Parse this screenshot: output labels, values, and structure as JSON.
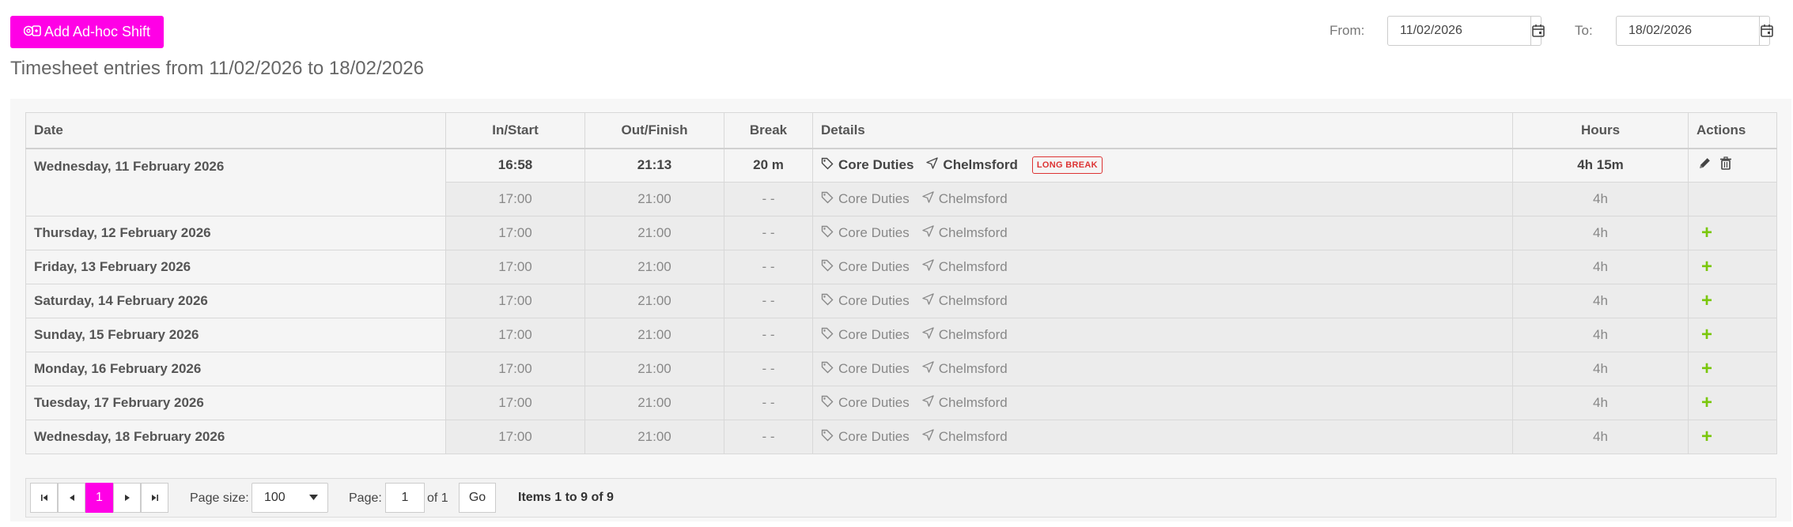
{
  "toolbar": {
    "add_shift_label": "Add Ad-hoc Shift",
    "from_label": "From:",
    "from_value": "11/02/2026",
    "to_label": "To:",
    "to_value": "18/02/2026"
  },
  "subtitle": "Timesheet entries from 11/02/2026 to 18/02/2026",
  "table": {
    "headers": {
      "date": "Date",
      "in_start": "In/Start",
      "out_finish": "Out/Finish",
      "break": "Break",
      "details": "Details",
      "hours": "Hours",
      "actions": "Actions"
    },
    "first_day": {
      "date": "Wednesday, 11 February 2026",
      "actual": {
        "in": "16:58",
        "out": "21:13",
        "break": "20 m",
        "duty": "Core Duties",
        "location": "Chelmsford",
        "badge": "LONG BREAK",
        "hours": "4h 15m"
      },
      "scheduled": {
        "in": "17:00",
        "out": "21:00",
        "break": "- -",
        "duty": "Core Duties",
        "location": "Chelmsford",
        "hours": "4h"
      }
    },
    "rows": [
      {
        "date": "Thursday, 12 February 2026",
        "in": "17:00",
        "out": "21:00",
        "break": "- -",
        "duty": "Core Duties",
        "location": "Chelmsford",
        "hours": "4h",
        "action": "+"
      },
      {
        "date": "Friday, 13 February 2026",
        "in": "17:00",
        "out": "21:00",
        "break": "- -",
        "duty": "Core Duties",
        "location": "Chelmsford",
        "hours": "4h",
        "action": "+"
      },
      {
        "date": "Saturday, 14 February 2026",
        "in": "17:00",
        "out": "21:00",
        "break": "- -",
        "duty": "Core Duties",
        "location": "Chelmsford",
        "hours": "4h",
        "action": "+"
      },
      {
        "date": "Sunday, 15 February 2026",
        "in": "17:00",
        "out": "21:00",
        "break": "- -",
        "duty": "Core Duties",
        "location": "Chelmsford",
        "hours": "4h",
        "action": "+"
      },
      {
        "date": "Monday, 16 February 2026",
        "in": "17:00",
        "out": "21:00",
        "break": "- -",
        "duty": "Core Duties",
        "location": "Chelmsford",
        "hours": "4h",
        "action": "+"
      },
      {
        "date": "Tuesday, 17 February 2026",
        "in": "17:00",
        "out": "21:00",
        "break": "- -",
        "duty": "Core Duties",
        "location": "Chelmsford",
        "hours": "4h",
        "action": "+"
      },
      {
        "date": "Wednesday, 18 February 2026",
        "in": "17:00",
        "out": "21:00",
        "break": "- -",
        "duty": "Core Duties",
        "location": "Chelmsford",
        "hours": "4h",
        "action": "+"
      }
    ]
  },
  "pager": {
    "current_page": "1",
    "page_size_label": "Page size:",
    "page_size_value": "100",
    "page_label": "Page:",
    "page_input": "1",
    "of_label": "of 1",
    "go_label": "Go",
    "items_info": "Items 1 to 9 of 9"
  },
  "colors": {
    "accent": "#ff00e6",
    "badge_red": "#dd3333",
    "add_green": "#7ac70c"
  },
  "icons": [
    "calendar-plus-icon",
    "calendar-icon",
    "tag-icon",
    "location-arrow-icon",
    "pencil-icon",
    "trash-icon",
    "plus-icon",
    "first-page-icon",
    "prev-page-icon",
    "next-page-icon",
    "last-page-icon",
    "dropdown-caret-icon"
  ]
}
